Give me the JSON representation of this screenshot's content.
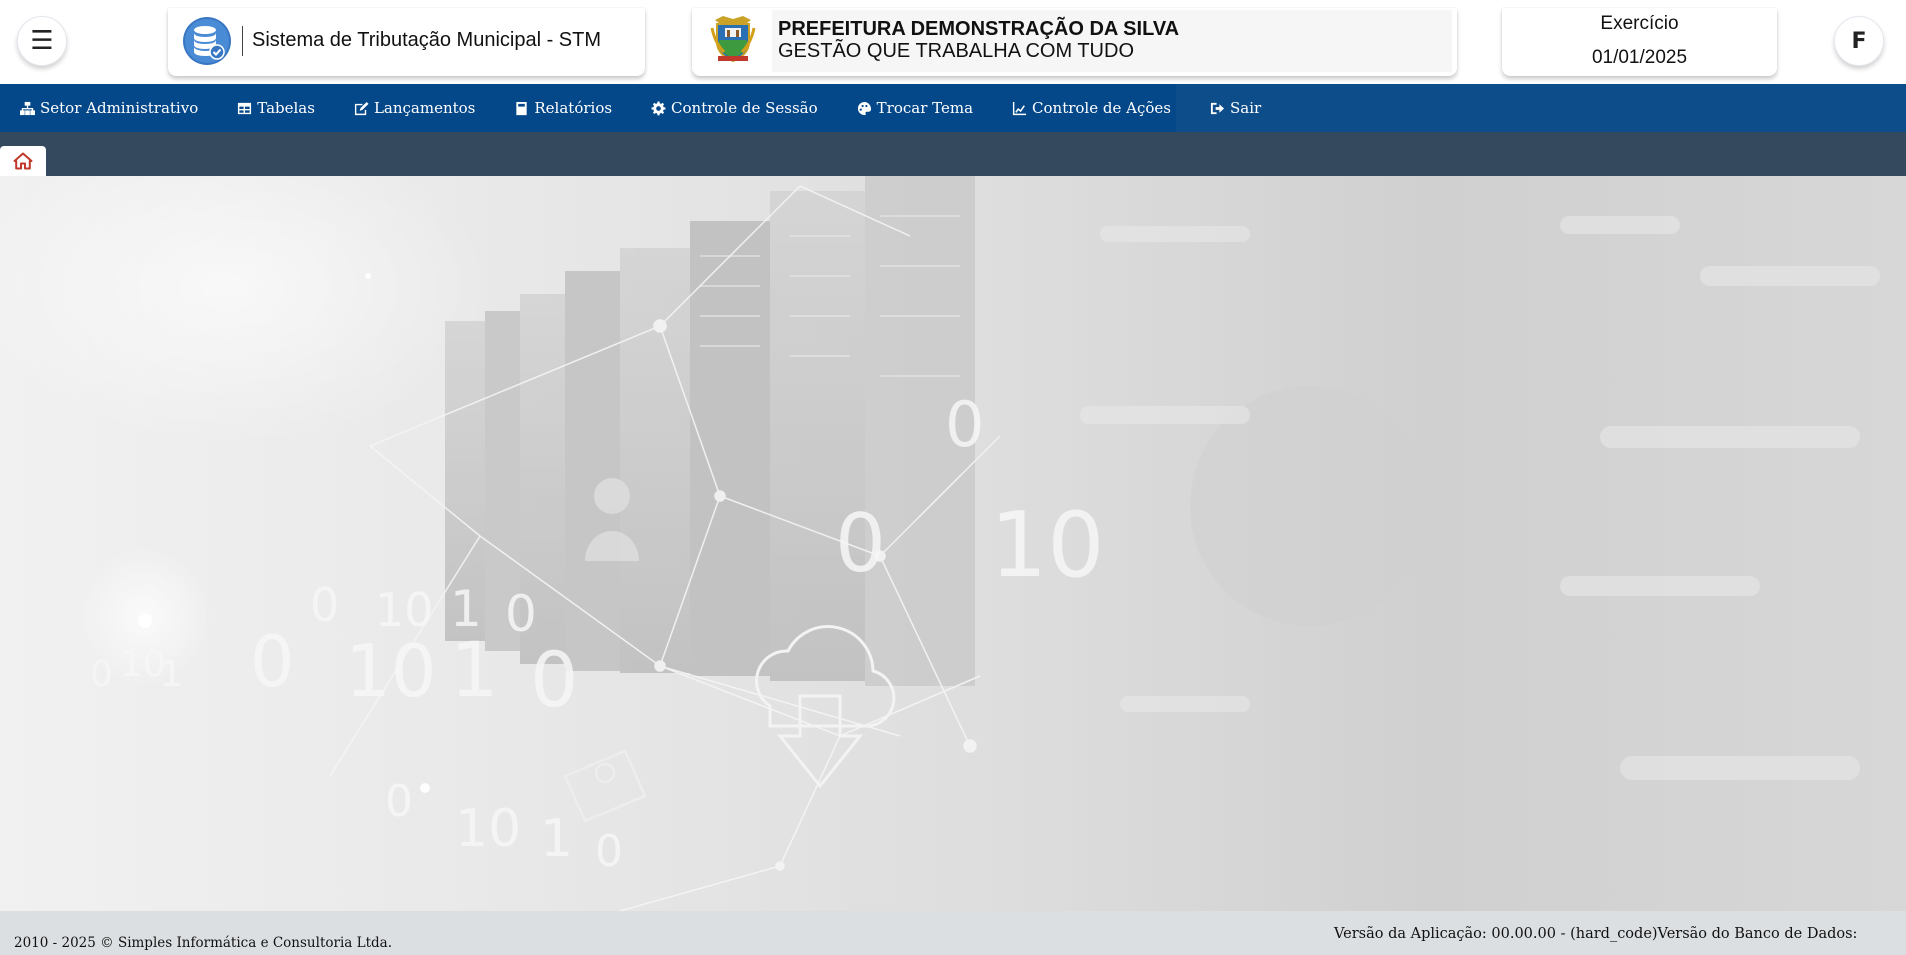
{
  "header": {
    "menu_icon": "hamburger-icon",
    "system_title": "Sistema de Tributação Municipal - STM",
    "prefeitura_name": "PREFEITURA DEMONSTRAÇÃO DA SILVA",
    "prefeitura_slogan": "GESTÃO QUE TRABALHA COM TUDO",
    "exercicio_label": "Exercício",
    "exercicio_date": "01/01/2025",
    "user_initial": "F"
  },
  "nav": {
    "items": [
      {
        "label": "Setor Administrativo",
        "icon": "sitemap-icon"
      },
      {
        "label": "Tabelas",
        "icon": "table-icon"
      },
      {
        "label": "Lançamentos",
        "icon": "edit-icon"
      },
      {
        "label": "Relatórios",
        "icon": "book-icon"
      },
      {
        "label": "Controle de Sessão",
        "icon": "gear-icon"
      },
      {
        "label": "Trocar Tema",
        "icon": "palette-icon"
      },
      {
        "label": "Controle de Ações",
        "icon": "chart-icon"
      },
      {
        "label": "Sair",
        "icon": "sign-out-icon"
      }
    ]
  },
  "tabs": {
    "home_icon": "home-icon"
  },
  "background": {
    "digits": [
      "0",
      "10",
      "0",
      "0",
      "10",
      "1",
      "0",
      "0",
      "10",
      "1",
      "0",
      "10",
      "1",
      "0",
      "0",
      "10",
      "1",
      "0"
    ]
  },
  "footer": {
    "copyright": "2010 - 2025 © Simples Informática e Consultoria Ltda.",
    "version": "Versão da Aplicação: 00.00.00 - (hard_code)Versão do Banco de Dados:"
  },
  "colors": {
    "nav_bg": "#04488a",
    "tabstrip_bg": "#34495e",
    "footer_bg": "#dcdfe2",
    "home_icon": "#c0392b"
  }
}
